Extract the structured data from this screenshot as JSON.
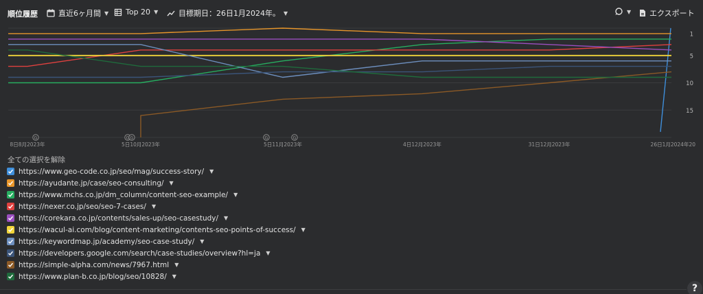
{
  "toolbar": {
    "title": "順位履歴",
    "period_label": "直近6ヶ月間",
    "top_label": "Top 20",
    "target_label": "目標期日：26日1月2024年。",
    "export_label": "エクスポート",
    "icons": [
      "calendar-icon",
      "table-icon",
      "trend-icon",
      "comment-icon",
      "document-icon"
    ]
  },
  "legend_header": "全ての選択を解除",
  "chart_data": {
    "type": "line",
    "x": [
      "8日8月2023年",
      "5日10月2023年",
      "5日11月2023年",
      "4日12月2023年",
      "31日12月2023年",
      "26日1月2024年"
    ],
    "x_tick_labels": [
      "8日8月2023年",
      "5日10月2023年",
      "5日11月2023年",
      "4日12月2023年",
      "31日12月2023年",
      "26日1月2024年"
    ],
    "x_tick_suffix": "20",
    "y_ticks": [
      1,
      5,
      10,
      15
    ],
    "ylim": [
      20,
      0
    ],
    "y_reversed": true,
    "grid": true,
    "annotations": [
      {
        "x": "8日8月2023年",
        "label": "G"
      },
      {
        "x": "5日10月2023年",
        "label": "G"
      },
      {
        "x": "5日10月2023年",
        "label": "G"
      },
      {
        "x": "5日11月2023年",
        "label": "G"
      },
      {
        "x": "5日11月2023年",
        "label": "G"
      }
    ],
    "series": [
      {
        "name": "https://www.geo-code.co.jp/seo/mag/success-story/",
        "color": "#3f8fdb",
        "points": [
          [
            "26日1月2024年",
            19
          ],
          [
            "26日1月2024年",
            0
          ]
        ]
      },
      {
        "name": "https://ayudante.jp/case/seo-consulting/",
        "color": "#e8962a",
        "points": [
          [
            "8日8月2023年",
            1
          ],
          [
            "5日10月2023年",
            1
          ],
          [
            "5日11月2023年",
            0
          ],
          [
            "4日12月2023年",
            1
          ],
          [
            "31日12月2023年",
            1
          ],
          [
            "26日1月2024年",
            1
          ]
        ]
      },
      {
        "name": "https://www.mchs.co.jp/dm_column/content-seo-example/",
        "color": "#27ae60",
        "points": [
          [
            "8日8月2023年",
            10
          ],
          [
            "5日10月2023年",
            10
          ],
          [
            "5日11月2023年",
            6
          ],
          [
            "4日12月2023年",
            3
          ],
          [
            "31日12月2023年",
            2
          ],
          [
            "26日1月2024年",
            2
          ]
        ]
      },
      {
        "name": "https://nexer.co.jp/seo/seo-7-cases/",
        "color": "#e0413f",
        "points": [
          [
            "8日8月2023年",
            7
          ],
          [
            "5日10月2023年",
            4
          ],
          [
            "5日11月2023年",
            4
          ],
          [
            "4日12月2023年",
            4
          ],
          [
            "31日12月2023年",
            4
          ],
          [
            "26日1月2024年",
            3
          ]
        ]
      },
      {
        "name": "https://corekara.co.jp/contents/sales-up/seo-casestudy/",
        "color": "#9b4fc0",
        "points": [
          [
            "8日8月2023年",
            2
          ],
          [
            "5日10月2023年",
            2
          ],
          [
            "5日11月2023年",
            2
          ],
          [
            "4日12月2023年",
            2
          ],
          [
            "31日12月2023年",
            3
          ],
          [
            "26日1月2024年",
            4
          ]
        ]
      },
      {
        "name": "https://wacul-ai.com/blog/content-marketing/contents-seo-points-of-success/",
        "color": "#f1d43a",
        "points": [
          [
            "8日8月2023年",
            5
          ],
          [
            "5日10月2023年",
            5
          ],
          [
            "5日11月2023年",
            5
          ],
          [
            "4日12月2023年",
            5
          ],
          [
            "31日12月2023年",
            5
          ],
          [
            "26日1月2024年",
            5
          ]
        ]
      },
      {
        "name": "https://keywordmap.jp/academy/seo-case-study/",
        "color": "#6d8fbf",
        "points": [
          [
            "8日8月2023年",
            3
          ],
          [
            "5日10月2023年",
            3
          ],
          [
            "5日11月2023年",
            9
          ],
          [
            "4日12月2023年",
            6
          ],
          [
            "31日12月2023年",
            6
          ],
          [
            "26日1月2024年",
            6
          ]
        ]
      },
      {
        "name": "https://developers.google.com/search/case-studies/overview?hl=ja",
        "color": "#3b5479",
        "points": [
          [
            "8日8月2023年",
            9
          ],
          [
            "5日10月2023年",
            9
          ],
          [
            "5日11月2023年",
            8
          ],
          [
            "4日12月2023年",
            8
          ],
          [
            "31日12月2023年",
            7
          ],
          [
            "26日1月2024年",
            7
          ]
        ]
      },
      {
        "name": "https://simple-alpha.com/news/7967.html",
        "color": "#8c5a26",
        "points": [
          [
            "5日10月2023年",
            20
          ],
          [
            "5日10月2023年",
            16
          ],
          [
            "5日11月2023年",
            13
          ],
          [
            "4日12月2023年",
            12
          ],
          [
            "31日12月2023年",
            10
          ],
          [
            "26日1月2024年",
            8
          ]
        ]
      },
      {
        "name": "https://www.plan-b.co.jp/blog/seo/10828/",
        "color": "#1f6b3c",
        "points": [
          [
            "8日8月2023年",
            4
          ],
          [
            "5日10月2023年",
            7
          ],
          [
            "5日11月2023年",
            7
          ],
          [
            "4日12月2023年",
            9
          ],
          [
            "31日12月2023年",
            9
          ],
          [
            "26日1月2024年",
            9
          ]
        ]
      }
    ]
  }
}
